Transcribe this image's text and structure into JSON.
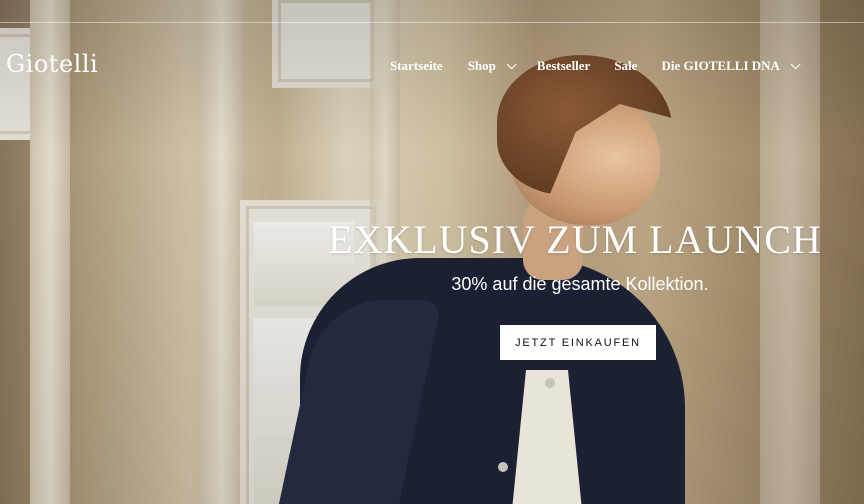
{
  "brand": {
    "logo_text": "Giotelli"
  },
  "nav": {
    "items": [
      {
        "label": "Startseite",
        "has_dropdown": false
      },
      {
        "label": "Shop",
        "has_dropdown": true
      },
      {
        "label": "Bestseller",
        "has_dropdown": false
      },
      {
        "label": "Sale",
        "has_dropdown": false
      },
      {
        "label": "Die GIOTELLI DNA",
        "has_dropdown": true
      }
    ]
  },
  "hero": {
    "headline": "EXKLUSIV ZUM LAUNCH",
    "subheadline": "30% auf die gesamte Kollektion.",
    "cta_label": "JETZT EINKAUFEN"
  },
  "colors": {
    "text_on_hero": "#ffffff",
    "button_bg": "#ffffff",
    "button_text": "#111111"
  }
}
